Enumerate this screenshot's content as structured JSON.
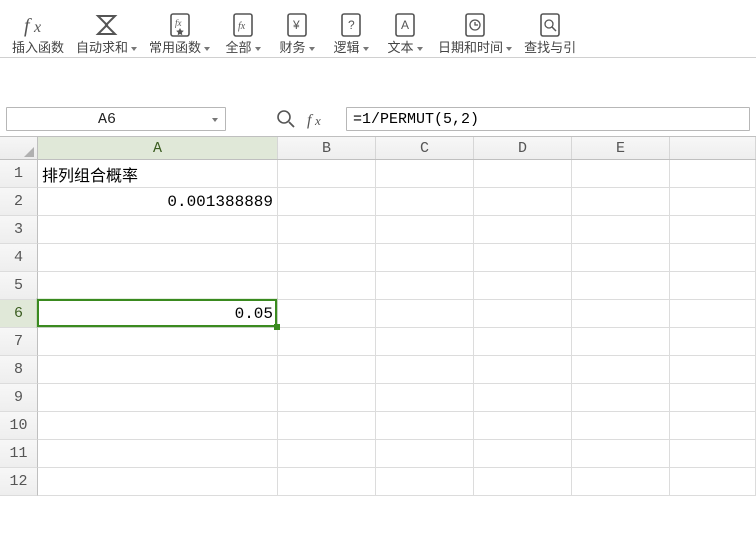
{
  "toolbar": {
    "insert_function": "插入函数",
    "autosum": "自动求和",
    "common": "常用函数",
    "all": "全部",
    "financial": "财务",
    "logical": "逻辑",
    "text": "文本",
    "date_time": "日期和时间",
    "lookup": "查找与引"
  },
  "formula_bar": {
    "name_box": "A6",
    "formula": "=1/PERMUT(5,2)"
  },
  "columns": {
    "labels": [
      "A",
      "B",
      "C",
      "D",
      "E"
    ],
    "widths": [
      240,
      98,
      98,
      98,
      98
    ],
    "active_index": 0
  },
  "rows": {
    "count": 12,
    "height": 28,
    "active_index": 5
  },
  "cells": {
    "A1": "排列组合概率",
    "A2": "0.001388889",
    "A6": "0.05"
  },
  "selection": {
    "col": 0,
    "row": 5
  },
  "chart_data": null
}
